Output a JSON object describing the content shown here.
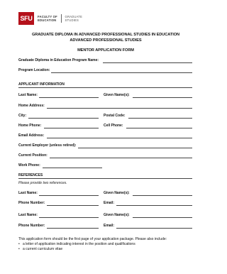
{
  "logo": {
    "mark": "SFU",
    "faculty_line1": "FACULTY OF",
    "faculty_line2": "EDUCATION",
    "grad_line1": "GRADUATE",
    "grad_line2": "STUDIES"
  },
  "title_line1": "GRADUATE DIPLOMA IN ADVANCED PROFESSIONAL STUDIES IN EDUCATION",
  "title_line2": "ADVANCED PROFESSIONAL STUDIES",
  "form_title": "MENTOR APPLICATION FORM",
  "program_name_label": "Graduate Diploma in Education Program Name:",
  "program_location_label": "Program Location:",
  "applicant_section": "APPLICANT INFORMATION",
  "applicant": {
    "last_name": "Last Name:",
    "given_names": "Given Name(s):",
    "home_address": "Home Address:",
    "city": "City:",
    "postal_code": "Postal Code:",
    "home_phone": "Home Phone:",
    "cell_phone": "Cell Phone:",
    "email": "Email Address:",
    "employer": "Current Employer (unless retired):",
    "position": "Current Position:",
    "work_phone": "Work Phone:"
  },
  "references_section": "REFERENCES",
  "references_note": "Please provide two references.",
  "ref1": {
    "last_name": "Last Name:",
    "given_names": "Given Name(s):",
    "phone": "Phone Number:",
    "email": "Email:"
  },
  "ref2": {
    "last_name": "Last Name:",
    "given_names": "Given Name(s):",
    "phone": "Phone Number:",
    "email": "Email:"
  },
  "closing_text": "This application form should be the first page of your application package. Please also include:",
  "bullets": [
    "a letter of application indicating interest in the position and qualifications",
    "a current curriculum vitae"
  ]
}
